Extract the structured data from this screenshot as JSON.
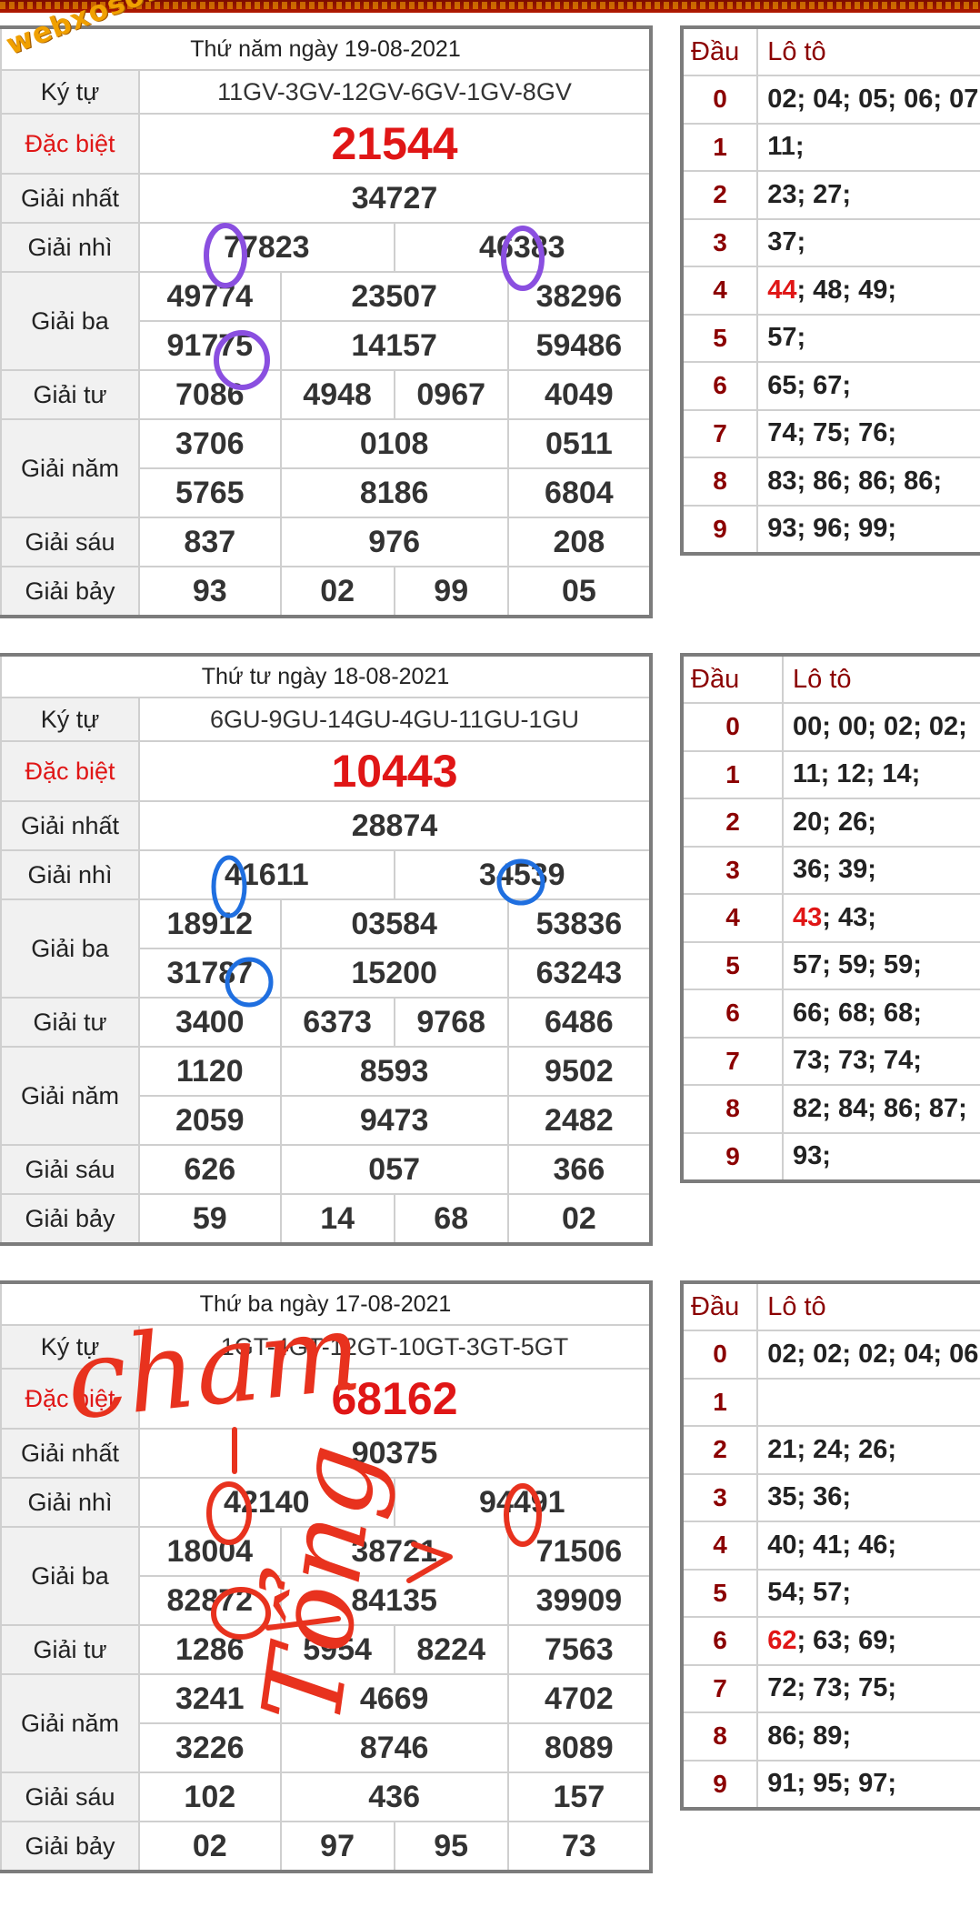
{
  "watermark": "webxoso.net",
  "labels": {
    "ky_tu": "Ký tự",
    "dac_biet": "Đặc biệt",
    "giai_nhat": "Giải nhất",
    "giai_nhi": "Giải nhì",
    "giai_ba": "Giải ba",
    "giai_tu": "Giải tư",
    "giai_nam": "Giải năm",
    "giai_sau": "Giải sáu",
    "giai_bay": "Giải bảy",
    "dau": "Đầu",
    "loto": "Lô tô"
  },
  "draws": [
    {
      "title": "Thứ năm ngày 19-08-2021",
      "ky_tu": "11GV-3GV-12GV-6GV-1GV-8GV",
      "dac_biet": "21544",
      "giai_nhat": "34727",
      "giai_nhi": [
        "77823",
        "46383"
      ],
      "giai_ba": [
        "49774",
        "23507",
        "38296",
        "91775",
        "14157",
        "59486"
      ],
      "giai_tu": [
        "7086",
        "4948",
        "0967",
        "4049"
      ],
      "giai_nam": [
        "3706",
        "0108",
        "0511",
        "5765",
        "8186",
        "6804"
      ],
      "giai_sau": [
        "837",
        "976",
        "208"
      ],
      "giai_bay": [
        "93",
        "02",
        "99",
        "05"
      ],
      "loto": [
        {
          "dau": "0",
          "hot": "",
          "rest": "02; 04; 05; 06; 07;"
        },
        {
          "dau": "1",
          "hot": "",
          "rest": "11;"
        },
        {
          "dau": "2",
          "hot": "",
          "rest": "23; 27;"
        },
        {
          "dau": "3",
          "hot": "",
          "rest": "37;"
        },
        {
          "dau": "4",
          "hot": "44",
          "rest": "; 48; 49;"
        },
        {
          "dau": "5",
          "hot": "",
          "rest": "57;"
        },
        {
          "dau": "6",
          "hot": "",
          "rest": "65; 67;"
        },
        {
          "dau": "7",
          "hot": "",
          "rest": "74; 75; 76;"
        },
        {
          "dau": "8",
          "hot": "",
          "rest": "83; 86; 86; 86;"
        },
        {
          "dau": "9",
          "hot": "",
          "rest": "93; 96; 99;"
        }
      ]
    },
    {
      "title": "Thứ tư ngày 18-08-2021",
      "ky_tu": "6GU-9GU-14GU-4GU-11GU-1GU",
      "dac_biet": "10443",
      "giai_nhat": "28874",
      "giai_nhi": [
        "41611",
        "34539"
      ],
      "giai_ba": [
        "18912",
        "03584",
        "53836",
        "31787",
        "15200",
        "63243"
      ],
      "giai_tu": [
        "3400",
        "6373",
        "9768",
        "6486"
      ],
      "giai_nam": [
        "1120",
        "8593",
        "9502",
        "2059",
        "9473",
        "2482"
      ],
      "giai_sau": [
        "626",
        "057",
        "366"
      ],
      "giai_bay": [
        "59",
        "14",
        "68",
        "02"
      ],
      "loto": [
        {
          "dau": "0",
          "hot": "",
          "rest": "00; 00; 02; 02;"
        },
        {
          "dau": "1",
          "hot": "",
          "rest": "11; 12; 14;"
        },
        {
          "dau": "2",
          "hot": "",
          "rest": "20; 26;"
        },
        {
          "dau": "3",
          "hot": "",
          "rest": "36; 39;"
        },
        {
          "dau": "4",
          "hot": "43",
          "rest": "; 43;"
        },
        {
          "dau": "5",
          "hot": "",
          "rest": "57; 59; 59;"
        },
        {
          "dau": "6",
          "hot": "",
          "rest": "66; 68; 68;"
        },
        {
          "dau": "7",
          "hot": "",
          "rest": "73; 73; 74;"
        },
        {
          "dau": "8",
          "hot": "",
          "rest": "82; 84; 86; 87;"
        },
        {
          "dau": "9",
          "hot": "",
          "rest": "93;"
        }
      ]
    },
    {
      "title": "Thứ ba ngày 17-08-2021",
      "ky_tu": "1GT-4GT-12GT-10GT-3GT-5GT",
      "dac_biet": "68162",
      "giai_nhat": "90375",
      "giai_nhi": [
        "42140",
        "94491"
      ],
      "giai_ba": [
        "18004",
        "38721",
        "71506",
        "82872",
        "84135",
        "39909"
      ],
      "giai_tu": [
        "1286",
        "5954",
        "8224",
        "7563"
      ],
      "giai_nam": [
        "3241",
        "4669",
        "4702",
        "3226",
        "8746",
        "8089"
      ],
      "giai_sau": [
        "102",
        "436",
        "157"
      ],
      "giai_bay": [
        "02",
        "97",
        "95",
        "73"
      ],
      "loto": [
        {
          "dau": "0",
          "hot": "",
          "rest": "02; 02; 02; 04; 06;"
        },
        {
          "dau": "1",
          "hot": "",
          "rest": ""
        },
        {
          "dau": "2",
          "hot": "",
          "rest": "21; 24; 26;"
        },
        {
          "dau": "3",
          "hot": "",
          "rest": "35; 36;"
        },
        {
          "dau": "4",
          "hot": "",
          "rest": "40; 41; 46;"
        },
        {
          "dau": "5",
          "hot": "",
          "rest": "54; 57;"
        },
        {
          "dau": "6",
          "hot": "62",
          "rest": "; 63; 69;"
        },
        {
          "dau": "7",
          "hot": "",
          "rest": "72; 73; 75;"
        },
        {
          "dau": "8",
          "hot": "",
          "rest": "86; 89;"
        },
        {
          "dau": "9",
          "hot": "",
          "rest": "91; 95; 97;"
        }
      ]
    }
  ],
  "handwriting": {
    "left": "cham",
    "right": "Tổng",
    "color": "#e8321e"
  },
  "colors": {
    "accent_red": "#e01616",
    "dau_red": "#8b0000",
    "circle_purple": "#8a4fe0",
    "circle_blue": "#1f6fe0",
    "circle_red": "#e8321e"
  }
}
